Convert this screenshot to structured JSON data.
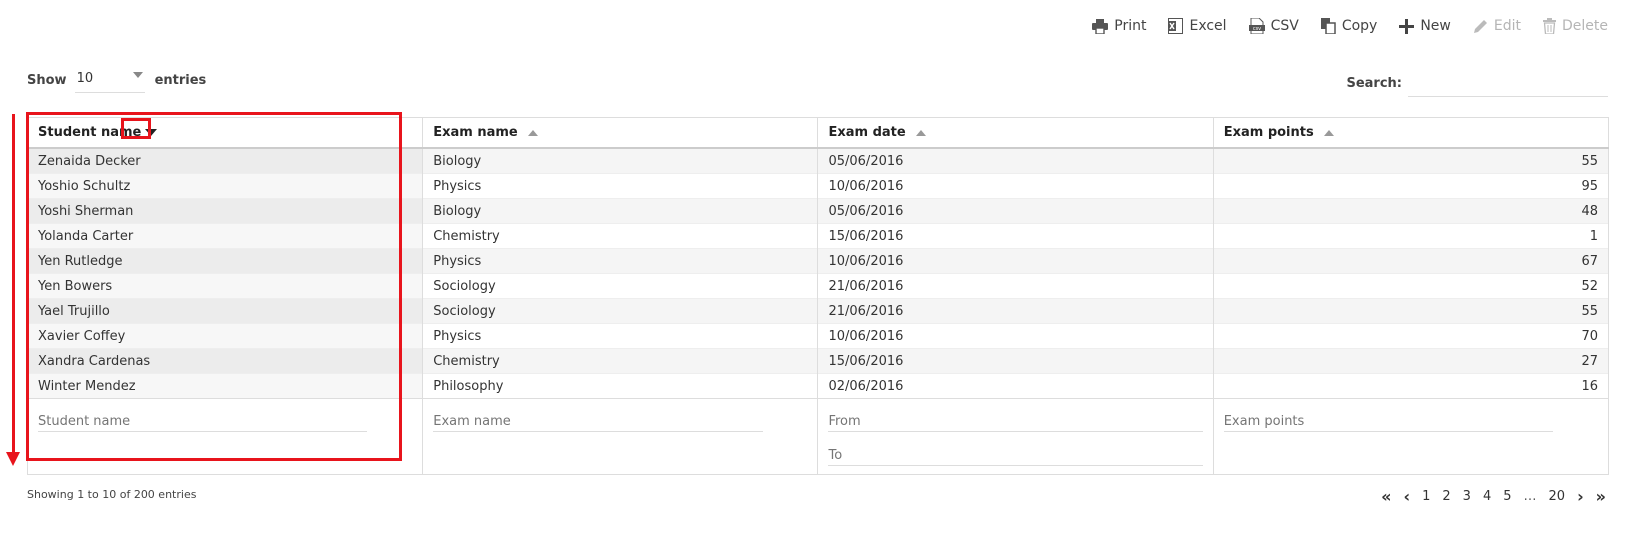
{
  "toolbar": {
    "print": "Print",
    "excel": "Excel",
    "csv": "CSV",
    "copy": "Copy",
    "new": "New",
    "edit": "Edit",
    "delete": "Delete"
  },
  "length": {
    "show_label": "Show",
    "value": "10",
    "entries_label": "entries"
  },
  "search": {
    "label": "Search:",
    "value": ""
  },
  "table": {
    "columns": [
      "Student name",
      "Exam name",
      "Exam date",
      "Exam points"
    ],
    "rows": [
      [
        "Zenaida Decker",
        "Biology",
        "05/06/2016",
        "55"
      ],
      [
        "Yoshio Schultz",
        "Physics",
        "10/06/2016",
        "95"
      ],
      [
        "Yoshi Sherman",
        "Biology",
        "05/06/2016",
        "48"
      ],
      [
        "Yolanda Carter",
        "Chemistry",
        "15/06/2016",
        "1"
      ],
      [
        "Yen Rutledge",
        "Physics",
        "10/06/2016",
        "67"
      ],
      [
        "Yen Bowers",
        "Sociology",
        "21/06/2016",
        "52"
      ],
      [
        "Yael Trujillo",
        "Sociology",
        "21/06/2016",
        "55"
      ],
      [
        "Xavier Coffey",
        "Physics",
        "10/06/2016",
        "70"
      ],
      [
        "Xandra Cardenas",
        "Chemistry",
        "15/06/2016",
        "27"
      ],
      [
        "Winter Mendez",
        "Philosophy",
        "02/06/2016",
        "16"
      ]
    ],
    "filters": {
      "student_name": "Student name",
      "exam_name": "Exam name",
      "from": "From",
      "to": "To",
      "exam_points": "Exam points"
    }
  },
  "info": "Showing 1 to 10 of 200 entries",
  "pagination": {
    "pages": [
      "1",
      "2",
      "3",
      "4",
      "5"
    ],
    "ellipsis": "…",
    "last": "20"
  },
  "colors": {
    "highlight": "#e8141c"
  }
}
